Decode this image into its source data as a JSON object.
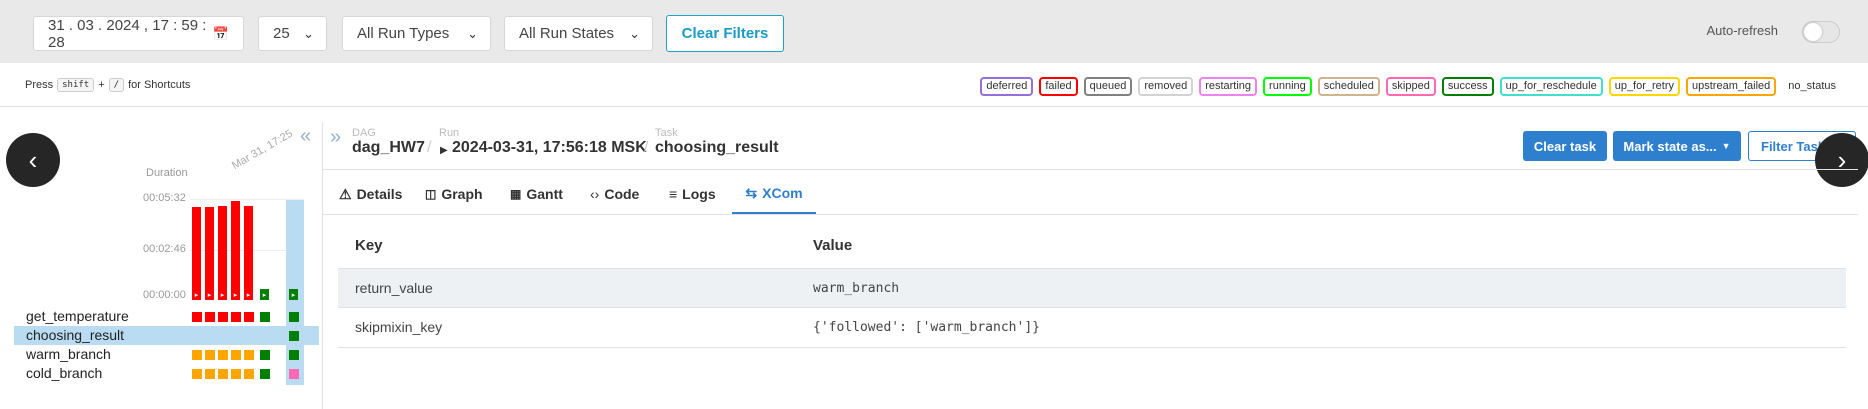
{
  "filters": {
    "datetime": "31 . 03 . 2024 ,  17 : 59 : 28",
    "limit": "25",
    "run_type": "All Run Types",
    "run_state": "All Run States",
    "clear": "Clear Filters",
    "autorefresh": "Auto-refresh"
  },
  "shortcuts": {
    "press": "Press",
    "key1": "shift",
    "plus": "+",
    "key2": "/",
    "suffix": "for Shortcuts"
  },
  "legend": [
    {
      "label": "deferred",
      "color": "#9370db"
    },
    {
      "label": "failed",
      "color": "#ff0000"
    },
    {
      "label": "queued",
      "color": "#808080"
    },
    {
      "label": "removed",
      "color": "#d3d3d3"
    },
    {
      "label": "restarting",
      "color": "#ee82ee"
    },
    {
      "label": "running",
      "color": "#00ff00"
    },
    {
      "label": "scheduled",
      "color": "#d2b48c"
    },
    {
      "label": "skipped",
      "color": "#ff69b4"
    },
    {
      "label": "success",
      "color": "#008000"
    },
    {
      "label": "up_for_reschedule",
      "color": "#40e0d0"
    },
    {
      "label": "up_for_retry",
      "color": "#ffd700"
    },
    {
      "label": "upstream_failed",
      "color": "#ffa500"
    },
    {
      "label": "no_status",
      "color": "none"
    }
  ],
  "grid": {
    "duration_label": "Duration",
    "ticks": [
      "00:05:32",
      "00:02:46",
      "00:00:00"
    ],
    "date_label": "Mar 31, 17:25",
    "runs": [
      {
        "duration_frac": 0.92,
        "state": "failed"
      },
      {
        "duration_frac": 0.92,
        "state": "failed"
      },
      {
        "duration_frac": 0.93,
        "state": "failed"
      },
      {
        "duration_frac": 0.98,
        "state": "failed"
      },
      {
        "duration_frac": 0.93,
        "state": "failed"
      },
      {
        "duration_frac": 0.0,
        "state": "success"
      },
      {
        "duration_frac": 0.0,
        "state": "success"
      }
    ],
    "tasks": [
      {
        "name": "get_temperature",
        "states": [
          "failed",
          "failed",
          "failed",
          "failed",
          "failed",
          "success",
          "success"
        ]
      },
      {
        "name": "choosing_result",
        "states": [
          "",
          "",
          "",
          "",
          "",
          "",
          "success"
        ],
        "selected": true
      },
      {
        "name": "warm_branch",
        "states": [
          "upstream_failed",
          "upstream_failed",
          "upstream_failed",
          "upstream_failed",
          "upstream_failed",
          "success",
          "success"
        ]
      },
      {
        "name": "cold_branch",
        "states": [
          "upstream_failed",
          "upstream_failed",
          "upstream_failed",
          "upstream_failed",
          "upstream_failed",
          "success",
          "skipped"
        ]
      }
    ]
  },
  "breadcrumb": {
    "dag_label": "DAG",
    "dag": "dag_HW7",
    "run_label": "Run",
    "run": "2024-03-31, 17:56:18 MSK",
    "task_label": "Task",
    "task": "choosing_result"
  },
  "actions": {
    "clear_task": "Clear task",
    "mark_state": "Mark state as...",
    "filter_tasks": "Filter Tasks"
  },
  "tabs": [
    {
      "label": "Details",
      "icon": "warning-triangle-icon"
    },
    {
      "label": "Graph",
      "icon": "graph-icon"
    },
    {
      "label": "Gantt",
      "icon": "gantt-icon"
    },
    {
      "label": "Code",
      "icon": "code-icon"
    },
    {
      "label": "Logs",
      "icon": "logs-icon"
    },
    {
      "label": "XCom",
      "icon": "xcom-icon",
      "active": true
    }
  ],
  "xcom": {
    "headers": [
      "Key",
      "Value"
    ],
    "rows": [
      {
        "key": "return_value",
        "value": "warm_branch"
      },
      {
        "key": "skipmixin_key",
        "value": "{'followed': ['warm_branch']}"
      }
    ]
  }
}
